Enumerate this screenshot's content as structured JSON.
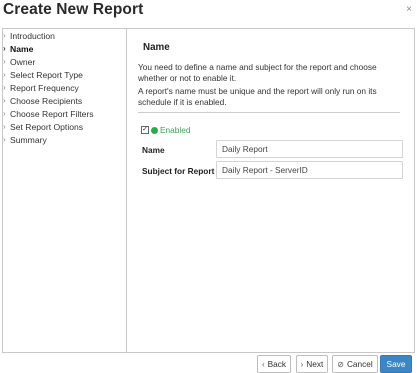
{
  "dialog": {
    "title": "Create New Report",
    "close_glyph": "×"
  },
  "sidebar": {
    "items": [
      {
        "label": "Introduction",
        "active": false
      },
      {
        "label": "Name",
        "active": true
      },
      {
        "label": "Owner",
        "active": false
      },
      {
        "label": "Select Report Type",
        "active": false
      },
      {
        "label": "Report Frequency",
        "active": false
      },
      {
        "label": "Choose Recipients",
        "active": false
      },
      {
        "label": "Choose Report Filters",
        "active": false
      },
      {
        "label": "Set Report Options",
        "active": false
      },
      {
        "label": "Summary",
        "active": false
      }
    ]
  },
  "main": {
    "section_title": "Name",
    "description_1": "You need to define a name and subject for the report and choose whether or not to enable it.",
    "description_2": "A report's name must be unique and the report will only run on its schedule if it is enabled.",
    "enabled": {
      "checked": true,
      "label": "Enabled",
      "status_color": "#2eaa4a"
    },
    "fields": {
      "name_label": "Name",
      "name_value": "Daily Report",
      "subject_label": "Subject for Report",
      "subject_value": "Daily Report - ServerID"
    }
  },
  "footer": {
    "back_label": "Back",
    "next_label": "Next",
    "cancel_label": "Cancel",
    "save_label": "Save",
    "save_color": "#3d86c6"
  }
}
